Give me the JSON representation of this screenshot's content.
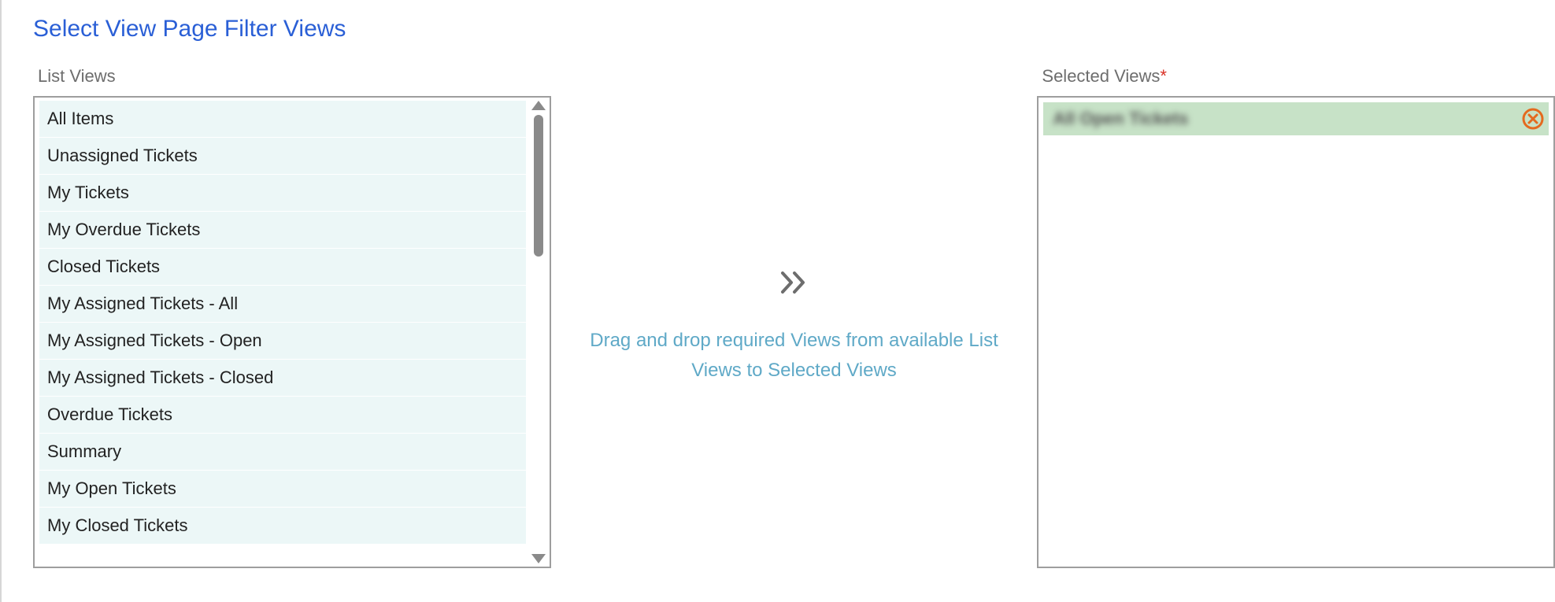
{
  "title": "Select View Page Filter Views",
  "labels": {
    "list_views": "List Views",
    "selected_views": "Selected Views",
    "required_marker": "*"
  },
  "hint": "Drag and drop required Views from available List Views to Selected Views",
  "list_views": [
    "All Items",
    "Unassigned Tickets",
    "My Tickets",
    "My Overdue Tickets",
    "Closed Tickets",
    "My Assigned Tickets - All",
    "My Assigned Tickets - Open",
    "My Assigned Tickets - Closed",
    "Overdue Tickets",
    "Summary",
    "My Open Tickets",
    "My Closed Tickets"
  ],
  "selected_views": [
    {
      "label": "All Open Tickets"
    }
  ],
  "icons": {
    "transfer": "double-chevron-right-icon",
    "remove": "close-circle-icon",
    "scroll_up": "triangle-up-icon",
    "scroll_down": "triangle-down-icon"
  },
  "colors": {
    "title": "#2a5fd6",
    "hint": "#5fa9c7",
    "list_item_bg": "#ecf7f7",
    "selected_item_bg": "#c7e2c7",
    "remove_icon": "#e46a1f",
    "required": "#d93025"
  }
}
